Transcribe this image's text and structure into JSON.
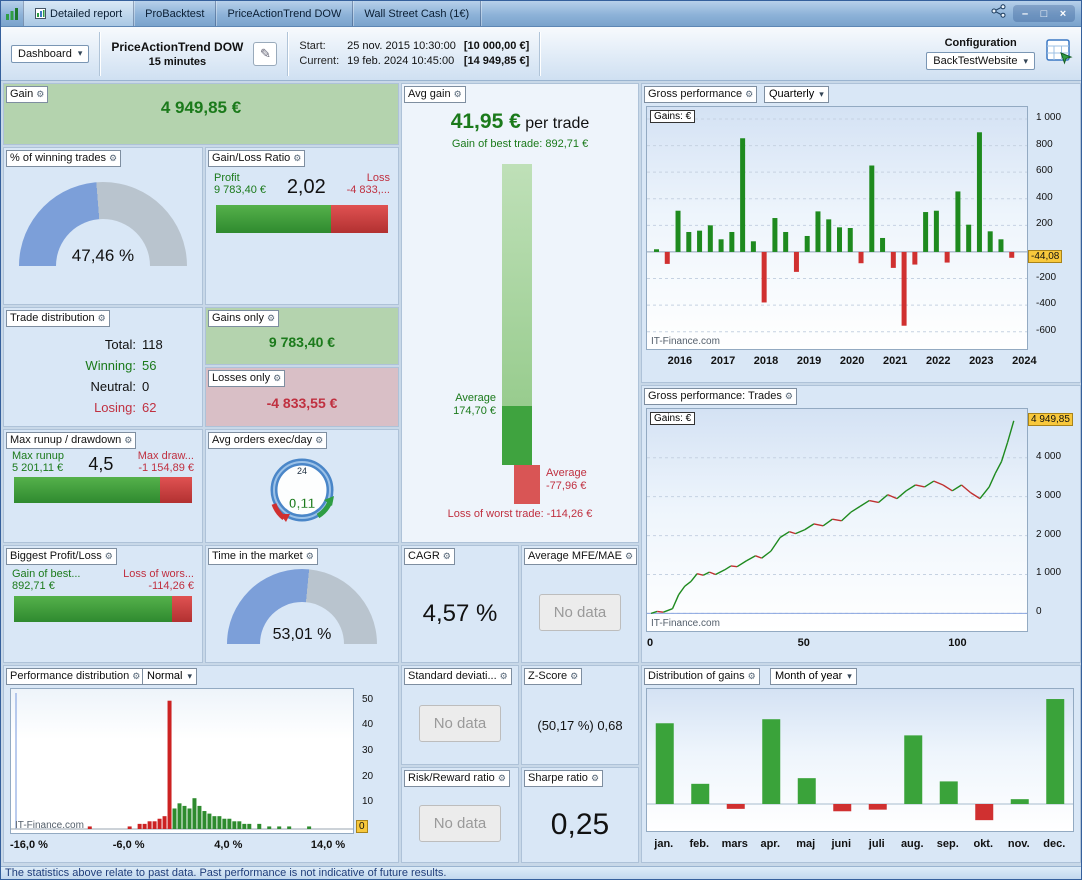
{
  "icons": {
    "wrench": "⚙",
    "pencil": "✎",
    "dropdown_arrow": "▾",
    "minimize": "–",
    "maximize": "□",
    "close": "×"
  },
  "titlebar": {
    "tabs": [
      "Detailed report",
      "ProBacktest",
      "PriceActionTrend DOW",
      "Wall Street Cash (1€)"
    ]
  },
  "toolbar": {
    "dashboard": "Dashboard",
    "strategy_name": "PriceActionTrend DOW",
    "strategy_timeframe": "15 minutes",
    "start_label": "Start:",
    "start_date": "25 nov. 2015 10:30:00",
    "start_value": "[10 000,00 €]",
    "current_label": "Current:",
    "current_date": "19 feb. 2024 10:45:00",
    "current_value": "[14 949,85 €]",
    "configuration_label": "Configuration",
    "configuration_value": "BackTestWebsite"
  },
  "panels": {
    "gain": {
      "title": "Gain",
      "value": "4 949,85 €"
    },
    "winning_trades": {
      "title": "% of winning trades",
      "value": "47,46 %",
      "percent": 47.46
    },
    "gain_loss_ratio": {
      "title": "Gain/Loss Ratio",
      "profit_label": "Profit",
      "profit_value": "9 783,40 €",
      "ratio": "2,02",
      "loss_label": "Loss",
      "loss_value": "-4 833,...",
      "green_pct": 66.9
    },
    "trade_distribution": {
      "title": "Trade distribution",
      "total_label": "Total:",
      "total_value": "118",
      "winning_label": "Winning:",
      "winning_value": "56",
      "neutral_label": "Neutral:",
      "neutral_value": "0",
      "losing_label": "Losing:",
      "losing_value": "62"
    },
    "gains_only": {
      "title": "Gains only",
      "value": "9 783,40 €"
    },
    "losses_only": {
      "title": "Losses only",
      "value": "-4 833,55 €"
    },
    "runup_drawdown": {
      "title": "Max runup / drawdown",
      "runup_label": "Max runup",
      "runup_value": "5 201,11 €",
      "ratio": "4,5",
      "drawdown_label": "Max draw...",
      "drawdown_value": "-1 154,89 €",
      "green_pct": 81.8
    },
    "avg_orders": {
      "title": "Avg orders exec/day",
      "value": "0,11",
      "clock_label": "24"
    },
    "biggest_profit_loss": {
      "title": "Biggest Profit/Loss",
      "gain_label": "Gain of best...",
      "gain_value": "892,71 €",
      "loss_label": "Loss of wors...",
      "loss_value": "-114,26 €",
      "green_pct": 88.6
    },
    "time_in_market": {
      "title": "Time in the market",
      "value": "53,01 %",
      "percent": 53.01
    },
    "performance_distribution": {
      "title": "Performance distribution",
      "mode": "Normal",
      "watermark": "IT-Finance.com"
    },
    "avg_gain": {
      "title": "Avg gain",
      "value": "41,95 €",
      "suffix": "per trade",
      "best_label": "Gain of best trade: 892,71 €",
      "avg_pos_line1": "Average",
      "avg_pos_line2": "174,70 €",
      "avg_neg_line1": "Average",
      "avg_neg_line2": "-77,96 €",
      "worst_label": "Loss of worst trade: -114,26 €",
      "best": 892.71,
      "average": 174.7,
      "avg_neg": -77.96,
      "worst": -114.26
    },
    "cagr": {
      "title": "CAGR",
      "value": "4,57 %"
    },
    "avg_mfe_mae": {
      "title": "Average MFE/MAE",
      "value": "No data"
    },
    "std_deviation": {
      "title": "Standard deviati...",
      "value": "No data"
    },
    "z_score": {
      "title": "Z-Score",
      "value": "(50,17 %) 0,68"
    },
    "risk_reward": {
      "title": "Risk/Reward ratio",
      "value": "No data"
    },
    "sharpe": {
      "title": "Sharpe ratio",
      "value": "0,25"
    },
    "gross_performance": {
      "title": "Gross performance",
      "mode": "Quarterly",
      "gains_label": "Gains: €",
      "watermark": "IT-Finance.com"
    },
    "gross_trades": {
      "title": "Gross performance: Trades",
      "gains_label": "Gains: €",
      "watermark": "IT-Finance.com"
    },
    "distribution_gains": {
      "title": "Distribution of gains",
      "mode": "Month of year"
    }
  },
  "chart_data": [
    {
      "id": "gross_performance_quarterly",
      "type": "bar",
      "title": "Gross performance (Quarterly) Gains: €",
      "categories": [
        "2015Q4",
        "2016Q1",
        "2016Q2",
        "2016Q3",
        "2016Q4",
        "2017Q1",
        "2017Q2",
        "2017Q3",
        "2017Q4",
        "2018Q1",
        "2018Q2",
        "2018Q3",
        "2018Q4",
        "2019Q1",
        "2019Q2",
        "2019Q3",
        "2019Q4",
        "2020Q1",
        "2020Q2",
        "2020Q3",
        "2020Q4",
        "2021Q1",
        "2021Q2",
        "2021Q3",
        "2021Q4",
        "2022Q1",
        "2022Q2",
        "2022Q3",
        "2022Q4",
        "2023Q1",
        "2023Q2",
        "2023Q3",
        "2023Q4",
        "2024Q1"
      ],
      "values": [
        20,
        -90,
        310,
        150,
        160,
        200,
        95,
        150,
        855,
        80,
        -380,
        255,
        150,
        -150,
        120,
        305,
        245,
        185,
        180,
        -85,
        650,
        105,
        -120,
        -555,
        -95,
        300,
        310,
        -80,
        455,
        205,
        900,
        155,
        95,
        -44.08
      ],
      "xtick_labels": [
        "2016",
        "2017",
        "2018",
        "2019",
        "2020",
        "2021",
        "2022",
        "2023",
        "2024"
      ],
      "yticks": [
        {
          "v": 1000,
          "label": "1 000"
        },
        {
          "v": 800,
          "label": "800"
        },
        {
          "v": 600,
          "label": "600"
        },
        {
          "v": 400,
          "label": "400"
        },
        {
          "v": 200,
          "label": "200"
        },
        {
          "v": -200,
          "label": "-200"
        },
        {
          "v": -400,
          "label": "-400"
        },
        {
          "v": -600,
          "label": "-600"
        }
      ],
      "ylim": [
        -700,
        1060
      ],
      "current": {
        "label": "-44,08",
        "value": -44.08
      },
      "positive_color": "#1e8a1e",
      "negative_color": "#d03030"
    },
    {
      "id": "gross_performance_trades",
      "type": "line",
      "title": "Gross performance: Trades Gains: €",
      "points": [
        [
          0,
          0
        ],
        [
          2,
          50
        ],
        [
          4,
          30
        ],
        [
          7,
          120
        ],
        [
          9,
          480
        ],
        [
          11,
          700
        ],
        [
          13,
          820
        ],
        [
          15,
          1020
        ],
        [
          17,
          980
        ],
        [
          19,
          1060
        ],
        [
          21,
          1000
        ],
        [
          24,
          1120
        ],
        [
          26,
          1220
        ],
        [
          28,
          1200
        ],
        [
          31,
          1350
        ],
        [
          34,
          1480
        ],
        [
          36,
          1420
        ],
        [
          39,
          1600
        ],
        [
          42,
          1950
        ],
        [
          45,
          2100
        ],
        [
          47,
          2050
        ],
        [
          50,
          2150
        ],
        [
          53,
          2300
        ],
        [
          56,
          2250
        ],
        [
          59,
          2420
        ],
        [
          62,
          2380
        ],
        [
          65,
          2600
        ],
        [
          68,
          2750
        ],
        [
          71,
          2900
        ],
        [
          74,
          2850
        ],
        [
          77,
          3050
        ],
        [
          80,
          2950
        ],
        [
          83,
          3150
        ],
        [
          86,
          3300
        ],
        [
          89,
          3250
        ],
        [
          92,
          3400
        ],
        [
          95,
          3300
        ],
        [
          98,
          3150
        ],
        [
          101,
          3300
        ],
        [
          104,
          3100
        ],
        [
          107,
          2950
        ],
        [
          110,
          3250
        ],
        [
          112,
          3600
        ],
        [
          114,
          3900
        ],
        [
          116,
          4400
        ],
        [
          118,
          4949.85
        ]
      ],
      "xticks": [
        {
          "v": 0,
          "label": "0"
        },
        {
          "v": 50,
          "label": "50"
        },
        {
          "v": 100,
          "label": "100"
        }
      ],
      "yticks": [
        {
          "v": 0,
          "label": "0"
        },
        {
          "v": 1000,
          "label": "1 000"
        },
        {
          "v": 2000,
          "label": "2 000"
        },
        {
          "v": 3000,
          "label": "3 000"
        },
        {
          "v": 4000,
          "label": "4 000"
        }
      ],
      "xlim": [
        0,
        121
      ],
      "ylim": [
        -350,
        5150
      ],
      "current": {
        "label": "4 949,85",
        "value": 4949.85
      },
      "up_color": "#1e8a1e",
      "down_color": "#c03030",
      "zero_line_color": "#8aa6e0"
    },
    {
      "id": "distribution_of_gains_month_of_year",
      "type": "bar",
      "categories": [
        "jan.",
        "feb.",
        "mars",
        "apr.",
        "maj",
        "juni",
        "juli",
        "aug.",
        "sep.",
        "okt.",
        "nov.",
        "dec."
      ],
      "values": [
        1000,
        250,
        -60,
        1050,
        320,
        -90,
        -70,
        850,
        280,
        -200,
        60,
        1300
      ],
      "ylim": [
        -260,
        1350
      ],
      "positive_color": "#3aa33a",
      "negative_color": "#d03030"
    },
    {
      "id": "performance_distribution_histogram",
      "type": "bar",
      "bins": [
        {
          "x": -10,
          "h": 1,
          "c": "r"
        },
        {
          "x": -6,
          "h": 1,
          "c": "r"
        },
        {
          "x": -5,
          "h": 2,
          "c": "r"
        },
        {
          "x": -4.5,
          "h": 2,
          "c": "r"
        },
        {
          "x": -4,
          "h": 3,
          "c": "r"
        },
        {
          "x": -3.5,
          "h": 3,
          "c": "r"
        },
        {
          "x": -3,
          "h": 4,
          "c": "r"
        },
        {
          "x": -2.5,
          "h": 5,
          "c": "r"
        },
        {
          "x": -2,
          "h": 50,
          "c": "r"
        },
        {
          "x": -1.5,
          "h": 8,
          "c": "g"
        },
        {
          "x": -1,
          "h": 10,
          "c": "g"
        },
        {
          "x": -0.5,
          "h": 9,
          "c": "g"
        },
        {
          "x": 0,
          "h": 8,
          "c": "g"
        },
        {
          "x": 0.5,
          "h": 12,
          "c": "g"
        },
        {
          "x": 1,
          "h": 9,
          "c": "g"
        },
        {
          "x": 1.5,
          "h": 7,
          "c": "g"
        },
        {
          "x": 2,
          "h": 6,
          "c": "g"
        },
        {
          "x": 2.5,
          "h": 5,
          "c": "g"
        },
        {
          "x": 3,
          "h": 5,
          "c": "g"
        },
        {
          "x": 3.5,
          "h": 4,
          "c": "g"
        },
        {
          "x": 4,
          "h": 4,
          "c": "g"
        },
        {
          "x": 4.5,
          "h": 3,
          "c": "g"
        },
        {
          "x": 5,
          "h": 3,
          "c": "g"
        },
        {
          "x": 5.5,
          "h": 2,
          "c": "g"
        },
        {
          "x": 6,
          "h": 2,
          "c": "g"
        },
        {
          "x": 7,
          "h": 2,
          "c": "g"
        },
        {
          "x": 8,
          "h": 1,
          "c": "g"
        },
        {
          "x": 9,
          "h": 1,
          "c": "g"
        },
        {
          "x": 10,
          "h": 1,
          "c": "g"
        },
        {
          "x": 12,
          "h": 1,
          "c": "g"
        }
      ],
      "xticks": [
        {
          "v": -16,
          "label": "-16,0 %"
        },
        {
          "v": -6,
          "label": "-6,0 %"
        },
        {
          "v": 4,
          "label": "4,0 %"
        },
        {
          "v": 14,
          "label": "14,0 %"
        }
      ],
      "yticks": [
        {
          "v": 50,
          "label": "50"
        },
        {
          "v": 40,
          "label": "40"
        },
        {
          "v": 30,
          "label": "30"
        },
        {
          "v": 20,
          "label": "20"
        },
        {
          "v": 10,
          "label": "10"
        }
      ],
      "zero_label": "0",
      "xlim": [
        -17.5,
        16
      ],
      "ylim": [
        0,
        53
      ],
      "positive_color": "#2e8b2e",
      "negative_color": "#cc2222"
    }
  ],
  "statusbar": {
    "text": "The statistics above relate to past data. Past performance is not indicative of future results."
  }
}
